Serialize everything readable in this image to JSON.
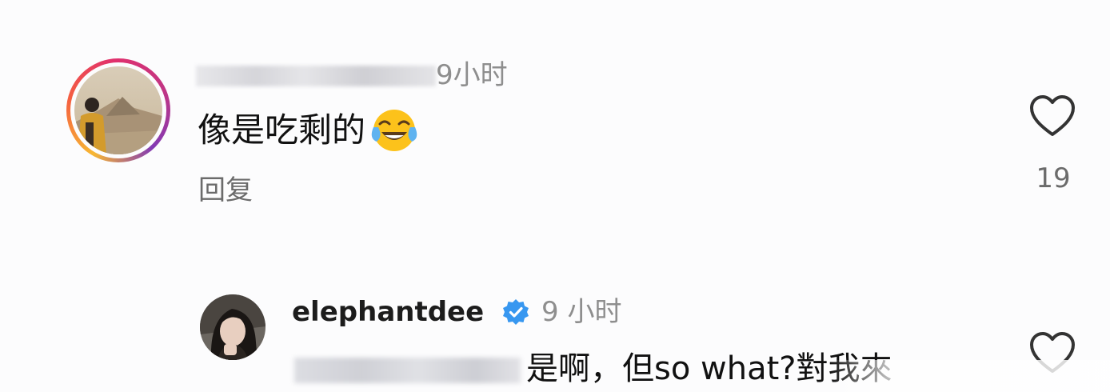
{
  "comments": [
    {
      "username": "",
      "time": "9小时",
      "text": "像是吃剩的",
      "emoji": "face-with-tears-of-joy",
      "reply_label": "回复",
      "likes": "19"
    },
    {
      "username": "elephantdee",
      "verified": true,
      "time": "9 小时",
      "mention": "",
      "text": "是啊，但so what?對我來"
    }
  ],
  "colors": {
    "background": "#fcfcfd",
    "secondary_text": "#8e8e8e",
    "verified_badge": "#3797f0",
    "story_ring": [
      "#f7b733",
      "#f56040",
      "#e1306c",
      "#c13584",
      "#833ab4"
    ]
  }
}
